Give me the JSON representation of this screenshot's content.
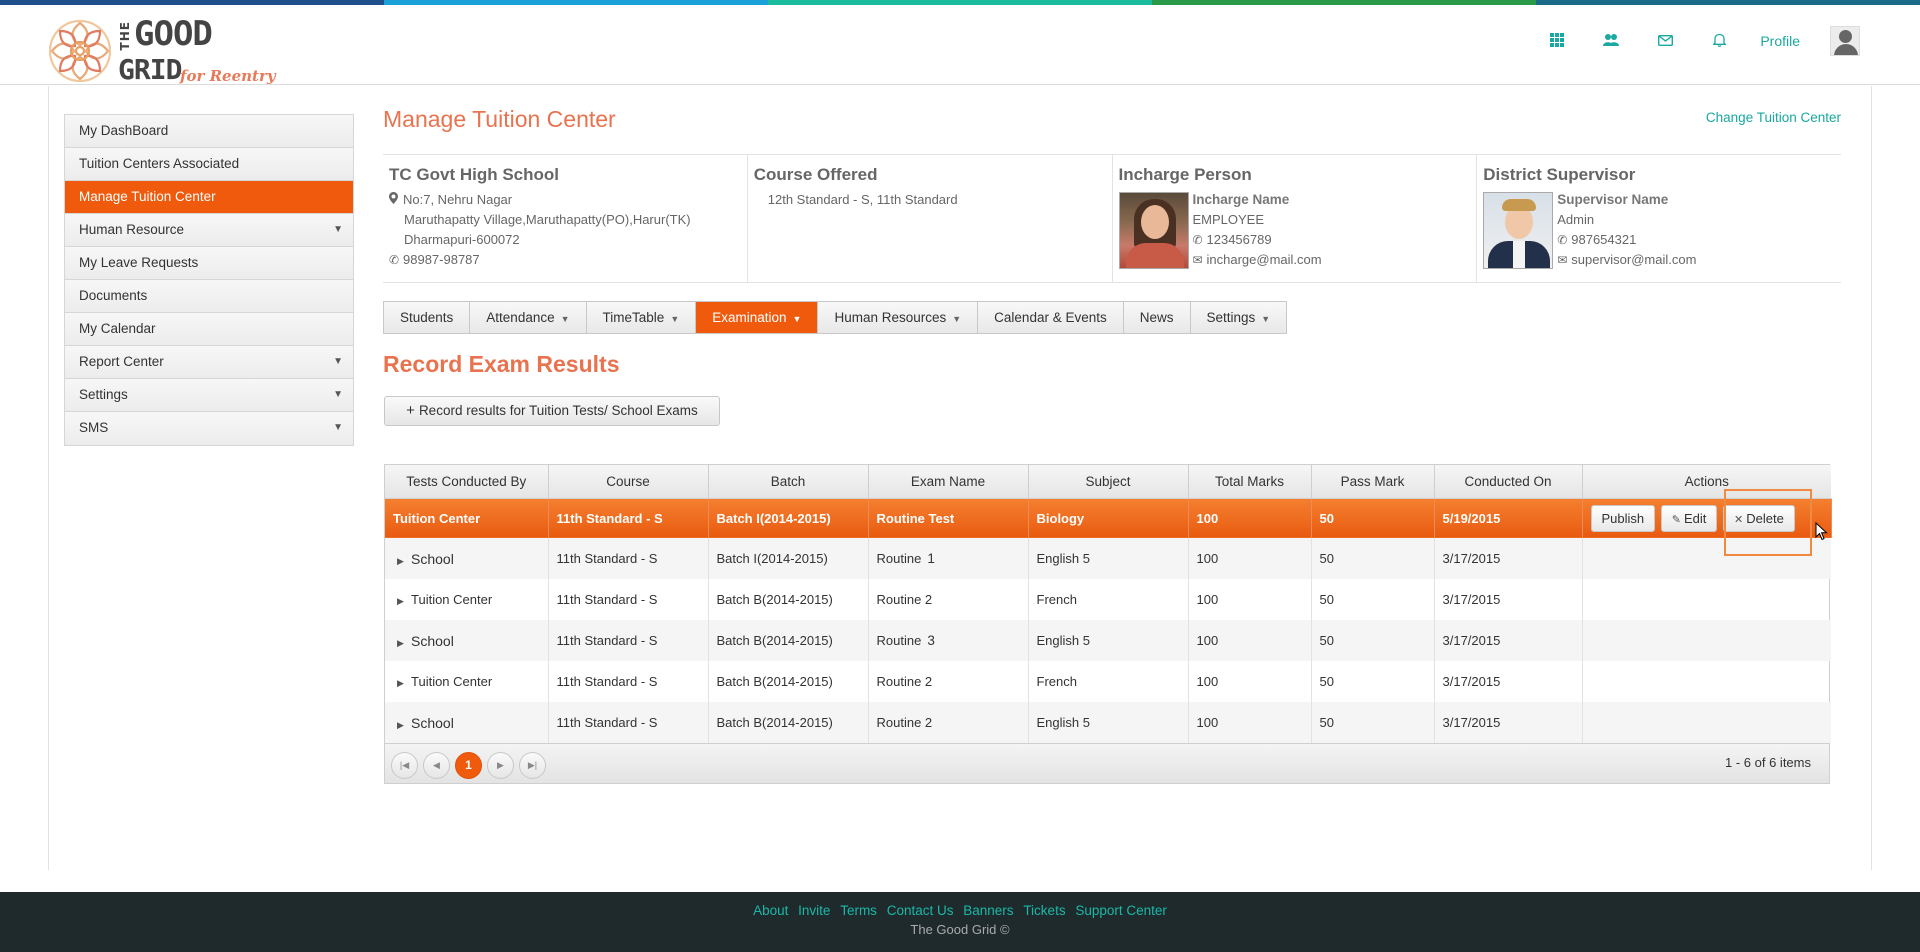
{
  "brand": {
    "logo_the": "THE",
    "logo_good": "GOOD",
    "logo_grid": "GRID",
    "logo_sub": "for Reentry",
    "stripe_colors": [
      "#1f4f8a",
      "#1aa0d8",
      "#1abca0",
      "#2a9a48",
      "#1a6a88"
    ]
  },
  "topnav": {
    "icons": [
      "apps-grid-icon",
      "people-icon",
      "mail-icon",
      "bell-icon"
    ],
    "profile_label": "Profile"
  },
  "sidebar": {
    "items": [
      {
        "label": "My DashBoard",
        "has_caret": false,
        "active": false
      },
      {
        "label": "Tuition Centers Associated",
        "has_caret": false,
        "active": false
      },
      {
        "label": "Manage Tuition Center",
        "has_caret": false,
        "active": true
      },
      {
        "label": "Human Resource",
        "has_caret": true,
        "active": false
      },
      {
        "label": "My Leave Requests",
        "has_caret": false,
        "active": false
      },
      {
        "label": "Documents",
        "has_caret": false,
        "active": false
      },
      {
        "label": "My Calendar",
        "has_caret": false,
        "active": false
      },
      {
        "label": "Report Center",
        "has_caret": true,
        "active": false
      },
      {
        "label": "Settings",
        "has_caret": true,
        "active": false
      },
      {
        "label": "SMS",
        "has_caret": true,
        "active": false
      }
    ]
  },
  "page": {
    "title": "Manage Tuition Center",
    "change_link": "Change Tuition Center"
  },
  "info": {
    "school": {
      "name": "TC Govt High School",
      "address1": "No:7, Nehru Nagar",
      "address2": "Maruthapatty Village,Maruthapatty(PO),Harur(TK)",
      "address3": "Dharmapuri-600072",
      "phone": "98987-98787"
    },
    "course": {
      "heading": "Course Offered",
      "value": "12th Standard - S, 11th Standard"
    },
    "incharge": {
      "heading": "Incharge Person",
      "name": "Incharge Name",
      "role": "EMPLOYEE",
      "phone": "123456789",
      "email": "incharge@mail.com"
    },
    "supervisor": {
      "heading": "District Supervisor",
      "name": "Supervisor Name",
      "role": "Admin",
      "phone": "987654321",
      "email": "supervisor@mail.com"
    }
  },
  "tabs": [
    {
      "label": "Students",
      "dropdown": false,
      "active": false
    },
    {
      "label": "Attendance",
      "dropdown": true,
      "active": false
    },
    {
      "label": "TimeTable",
      "dropdown": true,
      "active": false
    },
    {
      "label": "Examination",
      "dropdown": true,
      "active": true
    },
    {
      "label": "Human Resources",
      "dropdown": true,
      "active": false
    },
    {
      "label": "Calendar & Events",
      "dropdown": false,
      "active": false
    },
    {
      "label": "News",
      "dropdown": false,
      "active": false
    },
    {
      "label": "Settings",
      "dropdown": true,
      "active": false
    }
  ],
  "section": {
    "title": "Record Exam Results",
    "record_button": "Record results for Tuition Tests/ School Exams"
  },
  "grid": {
    "columns": [
      "Tests Conducted By",
      "Course",
      "Batch",
      "Exam Name",
      "Subject",
      "Total Marks",
      "Pass Mark",
      "Conducted On",
      "Actions"
    ],
    "selected_row": {
      "by": "Tuition Center",
      "course": "11th Standard - S",
      "batch": "Batch I(2014-2015)",
      "exam": "Routine Test",
      "subject": "Biology",
      "total": "100",
      "pass": "50",
      "date": "5/19/2015"
    },
    "actions": {
      "publish": "Publish",
      "edit": "Edit",
      "delete": "Delete"
    },
    "rows": [
      {
        "by": "School",
        "course": "11th Standard - S",
        "batch": "Batch I(2014-2015)",
        "exam": "Routine",
        "exam_num": "1",
        "subject": "English 5",
        "total": "100",
        "pass": "50",
        "date": "3/17/2015"
      },
      {
        "by": "Tuition Center",
        "course": "11th Standard - S",
        "batch": "Batch B(2014-2015)",
        "exam": "Routine 2",
        "exam_num": "",
        "subject": "French",
        "total": "100",
        "pass": "50",
        "date": "3/17/2015"
      },
      {
        "by": "School",
        "course": "11th Standard - S",
        "batch": "Batch B(2014-2015)",
        "exam": "Routine",
        "exam_num": "3",
        "subject": "English 5",
        "total": "100",
        "pass": "50",
        "date": "3/17/2015"
      },
      {
        "by": "Tuition Center",
        "course": "11th Standard - S",
        "batch": "Batch B(2014-2015)",
        "exam": "Routine 2",
        "exam_num": "",
        "subject": "French",
        "total": "100",
        "pass": "50",
        "date": "3/17/2015"
      },
      {
        "by": "School",
        "course": "11th Standard - S",
        "batch": "Batch B(2014-2015)",
        "exam": "Routine 2",
        "exam_num": "",
        "subject": "English 5",
        "total": "100",
        "pass": "50",
        "date": "3/17/2015"
      }
    ],
    "pager": {
      "current_page": "1",
      "info": "1 - 6 of 6 items"
    }
  },
  "footer": {
    "links": [
      "About",
      "Invite",
      "Terms",
      "Contact Us",
      "Banners",
      "Tickets",
      "Support Center"
    ],
    "copyright": "The Good Grid ©"
  }
}
